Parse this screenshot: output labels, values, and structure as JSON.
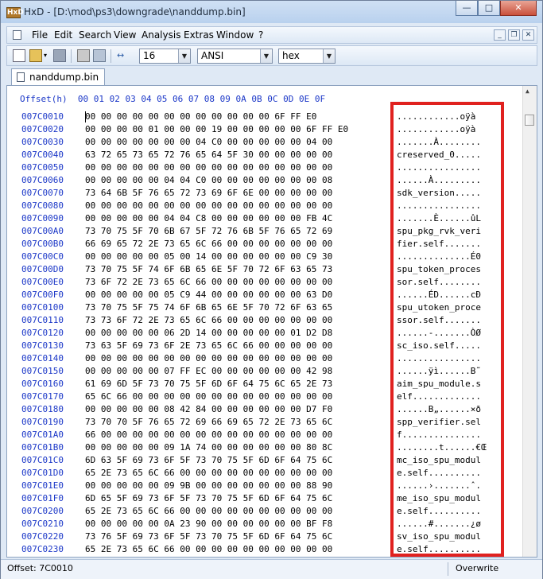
{
  "window": {
    "title": "HxD - [D:\\mod\\ps3\\downgrade\\nanddump.bin]",
    "app_icon_text": "HxD"
  },
  "menu": [
    "File",
    "Edit",
    "Search",
    "View",
    "Analysis",
    "Extras",
    "Window",
    "?"
  ],
  "toolbar": {
    "bytes_per_row": "16",
    "charset": "ANSI",
    "offset_base": "hex"
  },
  "tab": {
    "label": "nanddump.bin"
  },
  "editor": {
    "header": "Offset(h)  00 01 02 03 04 05 06 07 08 09 0A 0B 0C 0D 0E 0F",
    "offsets": [
      "007C0010",
      "007C0020",
      "007C0030",
      "007C0040",
      "007C0050",
      "007C0060",
      "007C0070",
      "007C0080",
      "007C0090",
      "007C00A0",
      "007C00B0",
      "007C00C0",
      "007C00D0",
      "007C00E0",
      "007C00F0",
      "007C0100",
      "007C0110",
      "007C0120",
      "007C0130",
      "007C0140",
      "007C0150",
      "007C0160",
      "007C0170",
      "007C0180",
      "007C0190",
      "007C01A0",
      "007C01B0",
      "007C01C0",
      "007C01D0",
      "007C01E0",
      "007C01F0",
      "007C0200",
      "007C0210",
      "007C0220",
      "007C0230"
    ],
    "hex": [
      "00 00 00 00 00 00 00 00 00 00 00 00 6F FF E0",
      "00 00 00 00 01 00 00 00 19 00 00 00 00 00 6F FF E0",
      "00 00 00 00 00 00 00 04 C0 00 00 00 00 00 04 00",
      "63 72 65 73 65 72 76 65 64 5F 30 00 00 00 00 00",
      "00 00 00 00 00 00 00 00 00 00 00 00 00 00 00 00",
      "00 00 00 00 00 04 04 C0 00 00 00 00 00 00 00 08",
      "73 64 6B 5F 76 65 72 73 69 6F 6E 00 00 00 00 00",
      "00 00 00 00 00 00 00 00 00 00 00 00 00 00 00 00",
      "00 00 00 00 00 04 04 C8 00 00 00 00 00 00 FB 4C",
      "73 70 75 5F 70 6B 67 5F 72 76 6B 5F 76 65 72 69",
      "66 69 65 72 2E 73 65 6C 66 00 00 00 00 00 00 00",
      "00 00 00 00 00 05 00 14 00 00 00 00 00 00 C9 30",
      "73 70 75 5F 74 6F 6B 65 6E 5F 70 72 6F 63 65 73",
      "73 6F 72 2E 73 65 6C 66 00 00 00 00 00 00 00 00",
      "00 00 00 00 00 05 C9 44 00 00 00 00 00 00 63 D0",
      "73 70 75 5F 75 74 6F 6B 65 6E 5F 70 72 6F 63 65",
      "73 73 6F 72 2E 73 65 6C 66 00 00 00 00 00 00 00",
      "00 00 00 00 00 06 2D 14 00 00 00 00 00 01 D2 D8",
      "73 63 5F 69 73 6F 2E 73 65 6C 66 00 00 00 00 00",
      "00 00 00 00 00 00 00 00 00 00 00 00 00 00 00 00",
      "00 00 00 00 00 07 FF EC 00 00 00 00 00 00 42 98",
      "61 69 6D 5F 73 70 75 5F 6D 6F 64 75 6C 65 2E 73",
      "65 6C 66 00 00 00 00 00 00 00 00 00 00 00 00 00",
      "00 00 00 00 00 08 42 84 00 00 00 00 00 00 D7 F0",
      "73 70 70 5F 76 65 72 69 66 69 65 72 2E 73 65 6C",
      "66 00 00 00 00 00 00 00 00 00 00 00 00 00 00 00",
      "00 00 00 00 00 09 1A 74 00 00 00 00 00 00 80 8C",
      "6D 63 5F 69 73 6F 5F 73 70 75 5F 6D 6F 64 75 6C",
      "65 2E 73 65 6C 66 00 00 00 00 00 00 00 00 00 00",
      "00 00 00 00 00 09 9B 00 00 00 00 00 00 00 88 90",
      "6D 65 5F 69 73 6F 5F 73 70 75 5F 6D 6F 64 75 6C",
      "65 2E 73 65 6C 66 00 00 00 00 00 00 00 00 00 00",
      "00 00 00 00 00 0A 23 90 00 00 00 00 00 00 BF F8",
      "73 76 5F 69 73 6F 5F 73 70 75 5F 6D 6F 64 75 6C",
      "65 2E 73 65 6C 66 00 00 00 00 00 00 00 00 00 00"
    ],
    "text": [
      "............oÿà",
      "............oÿà",
      ".......À........",
      "creserved_0.....",
      "................",
      "......À.........",
      "sdk_version.....",
      "................",
      ".......È......ûL",
      "spu_pkg_rvk_veri",
      "fier.self.......",
      "..............É0",
      "spu_token_proces",
      "sor.self........",
      "......ÉD......cÐ",
      "spu_utoken_proce",
      "ssor.self.......",
      "......-.......ÒØ",
      "sc_iso.self.....",
      "................",
      "......ÿì......B˜",
      "aim_spu_module.s",
      "elf.............",
      "......B„......×ð",
      "spp_verifier.sel",
      "f...............",
      "........t......€Œ",
      "mc_iso_spu_modul",
      "e.self..........",
      "......›.......ˆ.",
      "me_iso_spu_modul",
      "e.self..........",
      "......#.......¿ø",
      "sv_iso_spu_modul",
      "e.self.........."
    ]
  },
  "status": {
    "offset": "Offset: 7C0010",
    "mode": "Overwrite"
  }
}
